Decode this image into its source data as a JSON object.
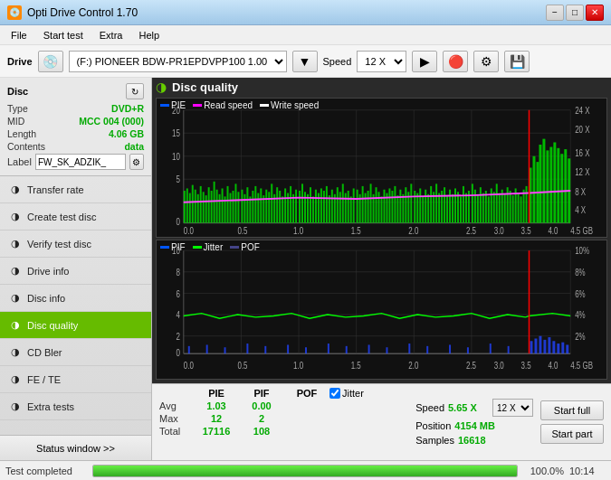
{
  "titleBar": {
    "title": "Opti Drive Control 1.70",
    "minimizeBtn": "−",
    "maximizeBtn": "□",
    "closeBtn": "✕"
  },
  "menuBar": {
    "items": [
      "File",
      "Start test",
      "Extra",
      "Help"
    ]
  },
  "driveBar": {
    "label": "Drive",
    "driveValue": "(F:)  PIONEER BDW-PR1EPDVPP100 1.00",
    "speedLabel": "Speed",
    "speedValue": "12 X"
  },
  "sidebar": {
    "discTitle": "Disc",
    "discInfo": [
      {
        "key": "Type",
        "val": "DVD+R",
        "green": true
      },
      {
        "key": "MID",
        "val": "MCC 004 (000)",
        "green": true
      },
      {
        "key": "Length",
        "val": "4.06 GB",
        "green": true
      },
      {
        "key": "Contents",
        "val": "data",
        "green": true
      }
    ],
    "labelKey": "Label",
    "labelValue": "FW_SK_ADZIK_",
    "navItems": [
      {
        "id": "transfer-rate",
        "label": "Transfer rate",
        "active": false
      },
      {
        "id": "create-test-disc",
        "label": "Create test disc",
        "active": false
      },
      {
        "id": "verify-test-disc",
        "label": "Verify test disc",
        "active": false
      },
      {
        "id": "drive-info",
        "label": "Drive info",
        "active": false
      },
      {
        "id": "disc-info",
        "label": "Disc info",
        "active": false
      },
      {
        "id": "disc-quality",
        "label": "Disc quality",
        "active": true
      },
      {
        "id": "cd-bler",
        "label": "CD Bler",
        "active": false
      },
      {
        "id": "fe-te",
        "label": "FE / TE",
        "active": false
      },
      {
        "id": "extra-tests",
        "label": "Extra tests",
        "active": false
      }
    ],
    "statusWindowBtn": "Status window >>"
  },
  "content": {
    "title": "Disc quality",
    "chart1": {
      "legend": [
        {
          "color": "#0055ff",
          "label": "PIE"
        },
        {
          "color": "#ff00ff",
          "label": "Read speed"
        },
        {
          "color": "#ffffff",
          "label": "Write speed"
        }
      ],
      "yLabels": [
        "20",
        "15",
        "10",
        "5",
        "0"
      ],
      "yLabelsRight": [
        "24 X",
        "20 X",
        "16 X",
        "12 X",
        "8 X",
        "4 X"
      ],
      "xLabels": [
        "0.0",
        "0.5",
        "1.0",
        "1.5",
        "2.0",
        "2.5",
        "3.0",
        "3.5",
        "4.0",
        "4.5 GB"
      ]
    },
    "chart2": {
      "legend": [
        {
          "color": "#0055ff",
          "label": "PIF"
        },
        {
          "color": "#00ff00",
          "label": "Jitter"
        },
        {
          "color": "#444488",
          "label": "POF"
        }
      ],
      "yLabels": [
        "10",
        "8",
        "6",
        "4",
        "2",
        "0"
      ],
      "yLabelsRight": [
        "10%",
        "8%",
        "6%",
        "4%",
        "2%"
      ],
      "xLabels": [
        "0.0",
        "0.5",
        "1.0",
        "1.5",
        "2.0",
        "2.5",
        "3.0",
        "3.5",
        "4.0",
        "4.5 GB"
      ]
    }
  },
  "stats": {
    "headers": [
      "PIE",
      "PIF",
      "POF",
      "Jitter",
      "Speed",
      ""
    ],
    "rows": [
      {
        "label": "Avg",
        "pie": "1.03",
        "pif": "0.00",
        "pof": "",
        "speed": "5.65 X"
      },
      {
        "label": "Max",
        "pie": "12",
        "pif": "2",
        "pof": ""
      },
      {
        "label": "Total",
        "pie": "17116",
        "pif": "108",
        "pof": ""
      }
    ],
    "jitterChecked": true,
    "jitterLabel": "Jitter",
    "speedSelectValue": "12 X",
    "positionLabel": "Position",
    "positionVal": "4154 MB",
    "samplesLabel": "Samples",
    "samplesVal": "16618",
    "startFullBtn": "Start full",
    "startPartBtn": "Start part"
  },
  "statusBar": {
    "text": "Test completed",
    "progress": 100,
    "progressText": "100.0%",
    "time": "10:14"
  }
}
